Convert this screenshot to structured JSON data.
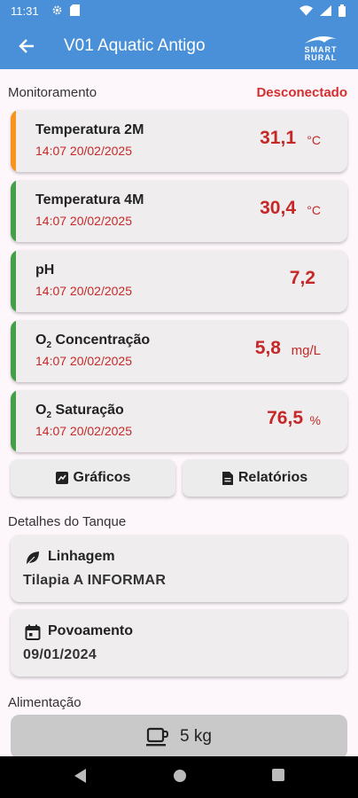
{
  "status_bar": {
    "time": "11:31"
  },
  "app_bar": {
    "title": "V01 Aquatic Antigo",
    "logo_line1": "SMART",
    "logo_line2": "RURAL"
  },
  "monitoring": {
    "title": "Monitoramento",
    "connection_status": "Desconectado",
    "sensors": [
      {
        "name": "Temperatura 2M",
        "date": "14:07 20/02/2025",
        "value": "31,1",
        "unit": "°C",
        "accent": "#f7931e"
      },
      {
        "name": "Temperatura 4M",
        "date": "14:07 20/02/2025",
        "value": "30,4",
        "unit": "°C",
        "accent": "#43a047"
      },
      {
        "name": "pH",
        "date": "14:07 20/02/2025",
        "value": "7,2",
        "unit": "",
        "accent": "#43a047"
      },
      {
        "name_prefix": "O",
        "name_sub": "2",
        "name_rest": " Concentração",
        "date": "14:07 20/02/2025",
        "value": "5,8",
        "unit": "mg/L",
        "accent": "#43a047"
      },
      {
        "name_prefix": "O",
        "name_sub": "2",
        "name_rest": " Saturação",
        "date": "14:07 20/02/2025",
        "value": "76,5",
        "unit": "%",
        "accent": "#43a047"
      }
    ]
  },
  "actions": {
    "charts_label": "Gráficos",
    "reports_label": "Relatórios"
  },
  "tank_details": {
    "title": "Detalhes do Tanque",
    "lineage_label": "Linhagem",
    "lineage_value": "Tilapia A INFORMAR",
    "stocking_label": "Povoamento",
    "stocking_value": "09/01/2024"
  },
  "feeding": {
    "title": "Alimentação",
    "amount": "5 kg"
  }
}
